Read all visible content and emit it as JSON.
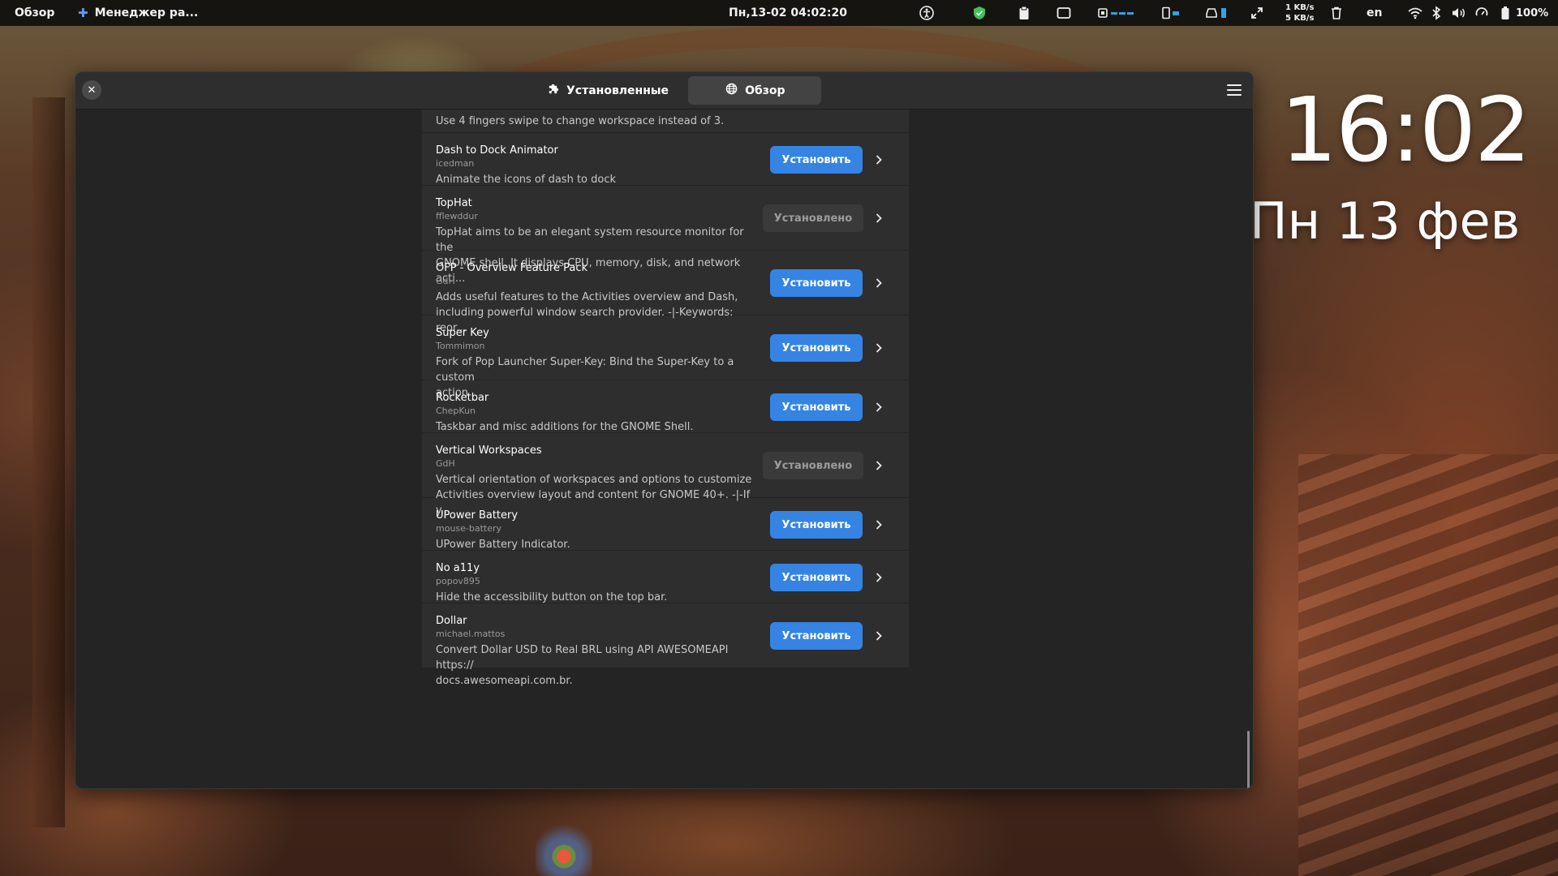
{
  "topbar": {
    "activities": "Обзор",
    "app_name": "Менеджер ра...",
    "clock": "Пн,13-02 04:02:20",
    "net_up": "1 KB/s",
    "net_down": "5 KB/s",
    "language": "en",
    "battery": "100%"
  },
  "desktop": {
    "time": "16:02",
    "date": "Пн 13 фев"
  },
  "window": {
    "tabs": [
      {
        "label": "Установленные",
        "icon": "puzzle-icon"
      },
      {
        "label": "Обзор",
        "icon": "globe-icon"
      }
    ],
    "active_tab": "Обзор",
    "partial_row_desc": "Use 4 fingers swipe to change workspace instead of 3.",
    "extensions": [
      {
        "name": "Dash to Dock Animator",
        "author": "icedman",
        "desc": [
          "Animate the icons of dash to dock"
        ],
        "button": "Установить"
      },
      {
        "name": "TopHat",
        "author": "fflewddur",
        "desc": [
          "TopHat aims to be an elegant system resource monitor for the",
          "GNOME shell. It displays CPU, memory, disk, and network acti..."
        ],
        "button": "Установлено"
      },
      {
        "name": "OFP - Overview Feature Pack",
        "author": "GdH",
        "desc": [
          "Adds useful features to the Activities overview and Dash,",
          "including powerful window search provider. -|-Keywords: reor..."
        ],
        "button": "Установить"
      },
      {
        "name": "Super Key",
        "author": "Tommimon",
        "desc": [
          "Fork of Pop Launcher Super-Key: Bind the Super-Key to a custom",
          "action"
        ],
        "button": "Установить"
      },
      {
        "name": "Rocketbar",
        "author": "ChepKun",
        "desc": [
          "Taskbar and misc additions for the GNOME Shell."
        ],
        "button": "Установить"
      },
      {
        "name": "Vertical Workspaces",
        "author": "GdH",
        "desc": [
          "Vertical orientation of workspaces and options to customize",
          "Activities overview layout and content for GNOME 40+. -|-If y..."
        ],
        "button": "Установлено"
      },
      {
        "name": "UPower Battery",
        "author": "mouse-battery",
        "desc": [
          "UPower Battery Indicator."
        ],
        "button": "Установить"
      },
      {
        "name": "No a11y",
        "author": "popov895",
        "desc": [
          "Hide the accessibility button on the top bar."
        ],
        "button": "Установить"
      },
      {
        "name": "Dollar",
        "author": "michael.mattos",
        "desc": [
          "Convert Dollar USD to Real BRL using API AWESOMEAPI https://",
          "docs.awesomeapi.com.br."
        ],
        "button": "Установить"
      }
    ]
  },
  "colors": {
    "accent": "#3584e4",
    "window_bg": "#242424",
    "row_bg": "#2e2e2e",
    "installed_btn": "#3a3a3a"
  }
}
